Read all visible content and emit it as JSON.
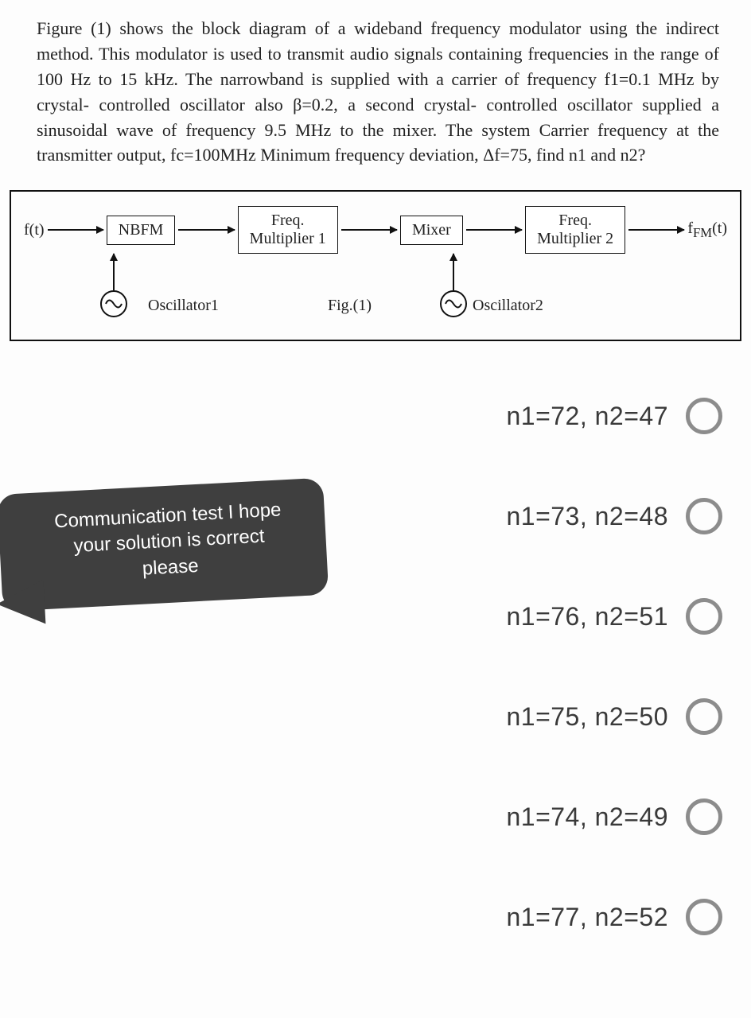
{
  "question": "Figure (1) shows the block diagram of a wideband frequency modulator using the indirect method. This modulator is used to transmit audio signals containing frequencies in the range of 100 Hz to 15 kHz. The narrowband is supplied with a carrier of frequency f1=0.1 MHz by crystal- controlled oscillator also β=0.2, a second crystal- controlled oscillator supplied a sinusoidal wave of frequency 9.5 MHz to the mixer. The system Carrier frequency at the transmitter output, fc=100MHz Minimum frequency deviation, Δf=75, find n1 and n2?",
  "diagram": {
    "input": "f(t)",
    "blocks": {
      "nbfm": "NBFM",
      "mult1_l1": "Freq.",
      "mult1_l2": "Multiplier 1",
      "mixer": "Mixer",
      "mult2_l1": "Freq.",
      "mult2_l2": "Multiplier 2"
    },
    "output": "fFM(t)",
    "osc1": "Oscillator1",
    "osc2": "Oscillator2",
    "fig": "Fig.(1)"
  },
  "bubble": {
    "line1": "Communication test I hope",
    "line2": "your solution is correct",
    "line3": "please"
  },
  "options": [
    "n1=72, n2=47",
    "n1=73, n2=48",
    "n1=76, n2=51",
    "n1=75, n2=50",
    "n1=74, n2=49",
    "n1=77, n2=52"
  ]
}
